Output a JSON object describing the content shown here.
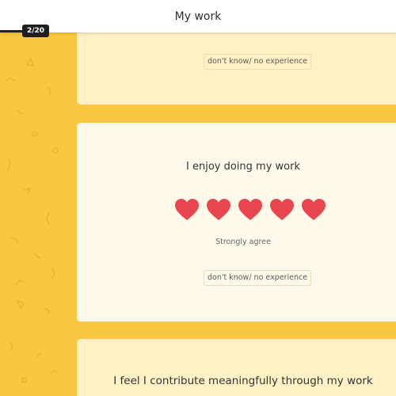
{
  "header": {
    "title": "My work",
    "progress_label": "2/20",
    "progress_fraction": 0.1
  },
  "cards": {
    "top": {
      "dont_know_label": "don't know/ no experience"
    },
    "mid": {
      "question": "I enjoy doing my work",
      "rating_value": 5,
      "rating_max": 5,
      "rating_label": "Strongly agree",
      "dont_know_label": "don't know/ no experience"
    },
    "bottom": {
      "question": "I feel I contribute meaningfully through my work"
    }
  },
  "colors": {
    "background": "#fbc740",
    "heart": "#e8464e",
    "card_active": "#fff9ec",
    "card_inactive": "#fff0c6"
  },
  "icons": [
    "heart-icon"
  ]
}
